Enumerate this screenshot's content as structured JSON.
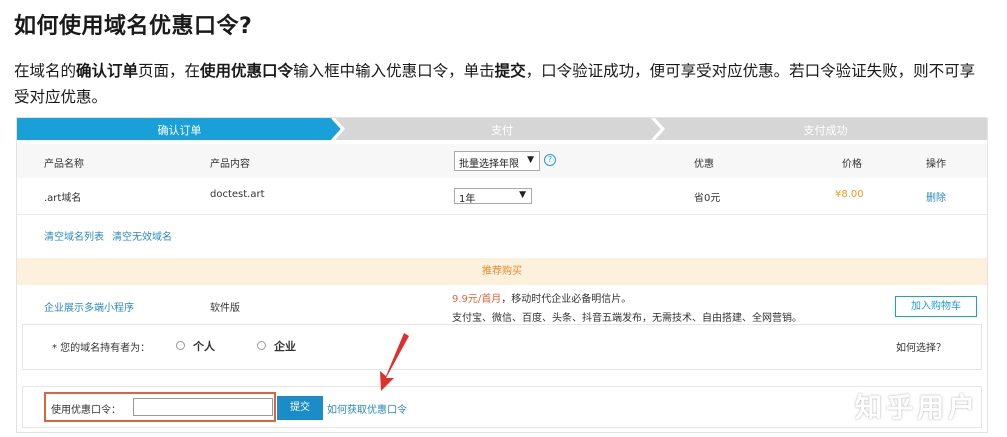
{
  "article": {
    "title": "如何使用域名优惠口令?",
    "para": {
      "t1": "在域名的",
      "b1": "确认订单",
      "t2": "页面，在",
      "b2": "使用优惠口令",
      "t3": "输入框中输入优惠口令，单击",
      "b3": "提交",
      "t4": "，口令验证成功，便可享受对应优惠。若口令验证失败，则不可享受对应优惠。"
    }
  },
  "steps": [
    {
      "label": "确认订单",
      "active": true
    },
    {
      "label": "支付",
      "active": false
    },
    {
      "label": "支付成功",
      "active": false
    }
  ],
  "colors": {
    "step_active": "#1aa0d8",
    "step_inactive": "#d6d6d6",
    "price": "#f29a1e",
    "link": "#2a8ab8",
    "highlight": "#e0643a"
  },
  "table": {
    "headers": {
      "product_name": "产品名称",
      "product_content": "产品内容",
      "batch_select": "批量选择年限",
      "discount": "优惠",
      "price": "价格",
      "action": "操作"
    },
    "row": {
      "name": ".art域名",
      "content": "doctest.art",
      "years": "1年",
      "discount": "省0元",
      "price": "¥8.00",
      "action": "删除"
    },
    "links": {
      "clear_list": "清空域名列表",
      "clear_invalid": "清空无效域名"
    }
  },
  "recommend": {
    "title": "推荐购买",
    "item_name": "企业展示多端小程序",
    "version": "软件版",
    "price_text": "9.9元/首月",
    "desc1": "，移动时代企业必备明信片。",
    "desc2": "支付宝、微信、百度、头条、抖音五端发布，无需技术、自由搭建、全网营销。",
    "cart_button": "加入购物车"
  },
  "owner": {
    "label": "* 您的域名持有者为：",
    "option_personal": "个人",
    "option_company": "企业",
    "help": "如何选择？"
  },
  "coupon": {
    "label": "使用优惠口令：",
    "value": "",
    "submit": "提交",
    "how_to": "如何获取优惠口令"
  },
  "watermark": "知乎用户"
}
